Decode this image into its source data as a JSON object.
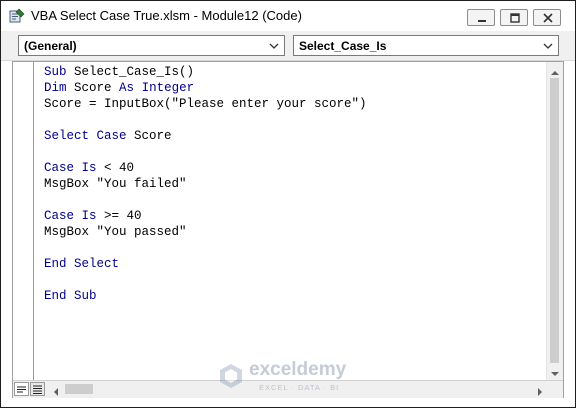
{
  "window": {
    "title": "VBA Select Case True.xlsm - Module12 (Code)"
  },
  "toolbar": {
    "object_combo": "(General)",
    "procedure_combo": "Select_Case_Is"
  },
  "code_lines": [
    [
      {
        "t": "Sub",
        "k": true
      },
      {
        "t": " Select_Case_Is()",
        "k": false
      }
    ],
    [
      {
        "t": "Dim",
        "k": true
      },
      {
        "t": " Score ",
        "k": false
      },
      {
        "t": "As",
        "k": true
      },
      {
        "t": " ",
        "k": false
      },
      {
        "t": "Integer",
        "k": true
      }
    ],
    [
      {
        "t": "Score = InputBox(\"Please enter your score\")",
        "k": false
      }
    ],
    [],
    [
      {
        "t": "Select Case",
        "k": true
      },
      {
        "t": " Score",
        "k": false
      }
    ],
    [],
    [
      {
        "t": "Case Is",
        "k": true
      },
      {
        "t": " < 40",
        "k": false
      }
    ],
    [
      {
        "t": "MsgBox \"You failed\"",
        "k": false
      }
    ],
    [],
    [
      {
        "t": "Case Is",
        "k": true
      },
      {
        "t": " >= 40",
        "k": false
      }
    ],
    [
      {
        "t": "MsgBox \"You passed\"",
        "k": false
      }
    ],
    [],
    [
      {
        "t": "End Select",
        "k": true
      }
    ],
    [],
    [
      {
        "t": "End Sub",
        "k": true
      }
    ]
  ],
  "watermark": {
    "name": "exceldemy",
    "tagline": "EXCEL · DATA · BI"
  },
  "colors": {
    "keyword": "#00008b",
    "text": "#000000"
  }
}
